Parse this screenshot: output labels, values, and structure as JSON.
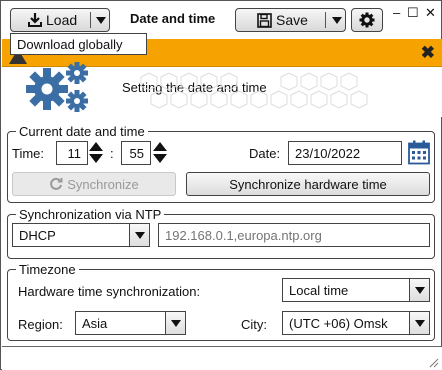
{
  "toolbar": {
    "load_label": "Load",
    "save_label": "Save",
    "title": "Date and time",
    "tooltip": "Download globally"
  },
  "window_controls": {
    "minimize": "–",
    "maximize": "☐",
    "close": "✕"
  },
  "banner": {
    "color": "#f6a200",
    "close": "✖"
  },
  "header": {
    "heading": "Setting the date and time"
  },
  "current": {
    "legend": "Current date and time",
    "time_label": "Time:",
    "hours": "11",
    "colon": ":",
    "minutes": "55",
    "date_label": "Date:",
    "date_value": "23/10/2022",
    "sync_label": "Synchronize",
    "sync_hw_label": "Synchronize hardware time"
  },
  "ntp": {
    "legend": "Synchronization via NTP",
    "mode": "DHCP",
    "servers_placeholder": "192.168.0.1,europa.ntp.org"
  },
  "timezone": {
    "legend": "Timezone",
    "hw_sync_label": "Hardware time synchronization:",
    "hw_sync_value": "Local time",
    "region_label": "Region:",
    "region_value": "Asia",
    "city_label": "City:",
    "city_value": "(UTC +06) Omsk"
  },
  "colors": {
    "accent": "#3a6ea5",
    "banner": "#f6a200",
    "disabled_text": "#9a9a9a"
  }
}
